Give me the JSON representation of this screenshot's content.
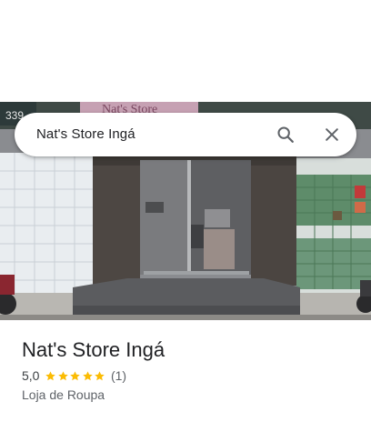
{
  "search": {
    "query": "Nat's Store Ingá",
    "search_icon": "search-icon",
    "close_icon": "close-icon"
  },
  "hero_image": {
    "storefront_sign": "Nat's Store",
    "storefront_number": "339"
  },
  "place": {
    "name": "Nat's Store Ingá",
    "rating": "5,0",
    "stars": 5,
    "review_count": "(1)",
    "category": "Loja de Roupa"
  },
  "colors": {
    "star": "#fbbc04",
    "primary_text": "#202124",
    "secondary_text": "#5f6368"
  }
}
